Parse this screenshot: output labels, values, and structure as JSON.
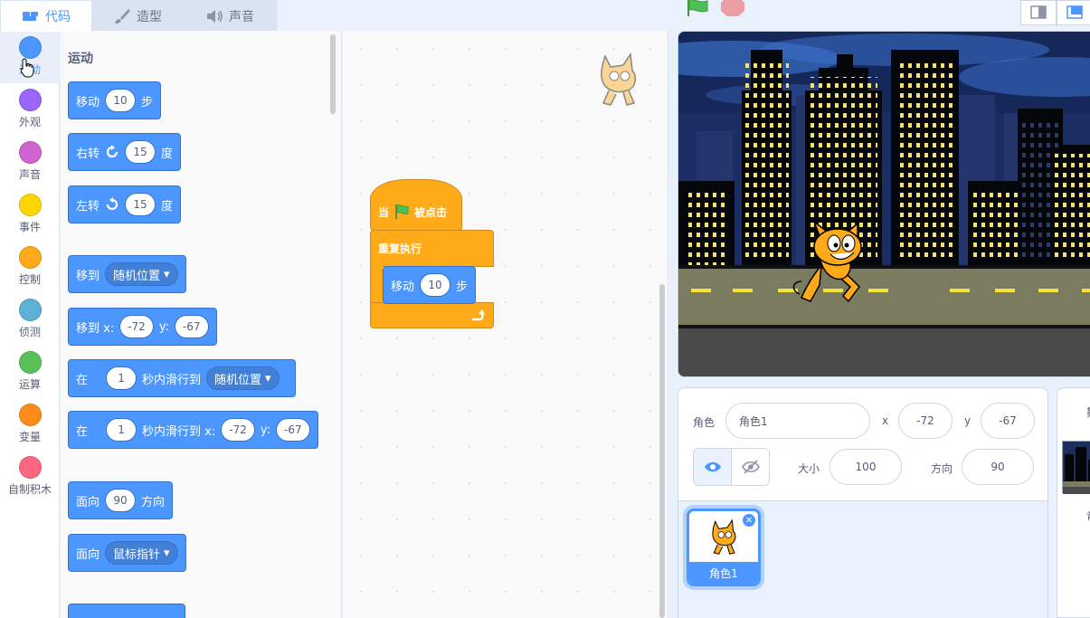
{
  "tabs": {
    "code": "代码",
    "costumes": "造型",
    "sounds": "声音"
  },
  "categories": [
    {
      "label": "运动",
      "color": "#4c97ff"
    },
    {
      "label": "外观",
      "color": "#9966ff"
    },
    {
      "label": "声音",
      "color": "#cf63cf"
    },
    {
      "label": "事件",
      "color": "#ffd500"
    },
    {
      "label": "控制",
      "color": "#ffab19"
    },
    {
      "label": "侦测",
      "color": "#5cb1d6"
    },
    {
      "label": "运算",
      "color": "#59c059"
    },
    {
      "label": "变量",
      "color": "#ff8c1a"
    },
    {
      "label": "自制积木",
      "color": "#ff6680"
    }
  ],
  "palette": {
    "heading": "运动",
    "blocks": {
      "move": {
        "label": "移动",
        "steps": "10",
        "unit": "步"
      },
      "turn_right": {
        "label": "右转",
        "degrees": "15",
        "unit": "度"
      },
      "turn_left": {
        "label": "左转",
        "degrees": "15",
        "unit": "度"
      },
      "goto": {
        "label": "移到",
        "target": "随机位置"
      },
      "goto_xy": {
        "label": "移到 x:",
        "x": "-72",
        "ylabel": "y:",
        "y": "-67"
      },
      "glide": {
        "label": "在",
        "secs": "1",
        "mid": "秒内滑行到",
        "target": "随机位置"
      },
      "glide_xy": {
        "label": "在",
        "secs": "1",
        "mid": "秒内滑行到 x:",
        "x": "-72",
        "ylabel": "y:",
        "y": "-67"
      },
      "point_dir": {
        "label": "面向",
        "dir": "90",
        "unit": "方向"
      },
      "point_towards": {
        "label": "面向",
        "target": "鼠标指针"
      }
    }
  },
  "script": {
    "hat": {
      "label_pre": "当",
      "label_post": "被点击"
    },
    "forever": {
      "label": "重复执行"
    },
    "move": {
      "label": "移动",
      "steps": "10",
      "unit": "步"
    }
  },
  "sprite_info": {
    "sprite_label": "角色",
    "sprite_name": "角色1",
    "x_label": "x",
    "x": "-72",
    "y_label": "y",
    "y": "-67",
    "size_label": "大小",
    "size": "100",
    "direction_label": "方向",
    "direction": "90"
  },
  "sprites": [
    {
      "name": "角色1"
    }
  ],
  "stage_pane": {
    "title_partial": "舞",
    "backdrop_label_partial": "背"
  },
  "colors": {
    "accent": "#4c97ff",
    "control": "#ffab19",
    "green_flag": "#4cbf56",
    "stop": "#ec5959"
  }
}
